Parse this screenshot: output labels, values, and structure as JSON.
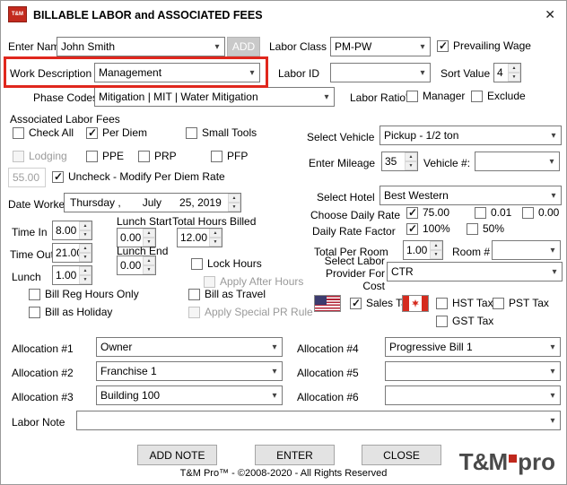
{
  "window": {
    "title": "BILLABLE LABOR and ASSOCIATED FEES",
    "icon_text": "T&M",
    "close_glyph": "✕"
  },
  "row1": {
    "enter_name_label": "Enter Name",
    "enter_name_value": "John Smith",
    "add_button": "ADD",
    "labor_class_label": "Labor Class",
    "labor_class_value": "PM-PW",
    "prevailing_wage_label": "Prevailing Wage",
    "prevailing_wage_checked": true
  },
  "row2": {
    "work_description_label": "Work Description",
    "work_description_value": "Management",
    "labor_id_label": "Labor ID",
    "labor_id_value": "",
    "sort_value_label": "Sort Value",
    "sort_value": "4"
  },
  "row3": {
    "phase_codes_label": "Phase Codes",
    "phase_codes_value": "Mitigation | MIT | Water Mitigation",
    "labor_ratios_label": "Labor Ratio's",
    "manager_label": "Manager",
    "manager_checked": false,
    "exclude_label": "Exclude",
    "exclude_checked": false
  },
  "fees": {
    "section_label": "Associated Labor Fees",
    "check_all_label": "Check All",
    "check_all_checked": false,
    "per_diem_label": "Per Diem",
    "per_diem_checked": true,
    "small_tools_label": "Small Tools",
    "small_tools_checked": false,
    "lodging_label": "Lodging",
    "lodging_checked": false,
    "ppe_label": "PPE",
    "ppe_checked": false,
    "prp_label": "PRP",
    "prp_checked": false,
    "pfp_label": "PFP",
    "pfp_checked": false,
    "per_diem_rate_value": "55.00",
    "uncheck_label": "Uncheck - Modify Per Diem Rate",
    "uncheck_checked": true
  },
  "vehicle": {
    "select_vehicle_label": "Select Vehicle",
    "select_vehicle_value": "Pickup - 1/2 ton",
    "enter_mileage_label": "Enter Mileage",
    "enter_mileage_value": "35",
    "vehicle_no_label": "Vehicle #:",
    "vehicle_no_value": ""
  },
  "hotel": {
    "select_hotel_label": "Select Hotel",
    "select_hotel_value": "Best Western",
    "choose_daily_rate_label": "Choose Daily Rate",
    "rate_75_label": "75.00",
    "rate_75_checked": true,
    "rate_001_label": "0.01",
    "rate_001_checked": false,
    "rate_000_label": "0.00",
    "rate_000_checked": false,
    "daily_rate_factor_label": "Daily Rate Factor",
    "factor_100_label": "100%",
    "factor_100_checked": true,
    "factor_50_label": "50%",
    "factor_50_checked": false,
    "total_per_room_label": "Total Per Room",
    "total_per_room_value": "1.00",
    "room_no_label": "Room #",
    "room_no_value": ""
  },
  "provider": {
    "label": "Select Labor Provider For Cost",
    "value": "CTR"
  },
  "taxes": {
    "sales_tax_label": "Sales Tax",
    "sales_tax_checked": true,
    "hst_label": "HST Tax",
    "hst_checked": false,
    "pst_label": "PST Tax",
    "pst_checked": false,
    "gst_label": "GST Tax",
    "gst_checked": false
  },
  "date": {
    "label": "Date Worked",
    "day": "Thursday ,",
    "month": "July",
    "rest": "25, 2019"
  },
  "time": {
    "time_in_label": "Time In",
    "time_in_value": "8.00",
    "time_out_label": "Time Out",
    "time_out_value": "21.00",
    "lunch_label": "Lunch",
    "lunch_value": "1.00",
    "lunch_start_label": "Lunch Start",
    "lunch_start_value": "0.00",
    "lunch_end_label": "Lunch End",
    "lunch_end_value": "0.00",
    "total_hours_label": "Total Hours Billed",
    "total_hours_value": "12.00",
    "lock_hours_label": "Lock Hours",
    "lock_hours_checked": false,
    "apply_after_hours_label": "Apply After Hours",
    "apply_after_hours_checked": false,
    "bill_reg_label": "Bill Reg Hours Only",
    "bill_reg_checked": false,
    "bill_travel_label": "Bill as Travel",
    "bill_travel_checked": false,
    "bill_holiday_label": "Bill as Holiday",
    "bill_holiday_checked": false,
    "apply_pr_label": "Apply Special PR Rule",
    "apply_pr_checked": false
  },
  "allocations": {
    "a1_label": "Allocation #1",
    "a1_value": "Owner",
    "a2_label": "Allocation #2",
    "a2_value": "Franchise 1",
    "a3_label": "Allocation #3",
    "a3_value": "Building 100",
    "a4_label": "Allocation #4",
    "a4_value": "Progressive Bill 1",
    "a5_label": "Allocation #5",
    "a5_value": "",
    "a6_label": "Allocation #6",
    "a6_value": ""
  },
  "labor_note": {
    "label": "Labor Note",
    "value": ""
  },
  "buttons": {
    "add_note": "ADD NOTE",
    "enter": "ENTER",
    "close": "CLOSE"
  },
  "footer": {
    "copyright": "T&M Pro™ - ©2008-2020 - All Rights Reserved",
    "logo_tm": "T&M",
    "logo_pro": "pro"
  },
  "colors": {
    "highlight_red": "#e0271d",
    "brand_red": "#c0281c"
  }
}
